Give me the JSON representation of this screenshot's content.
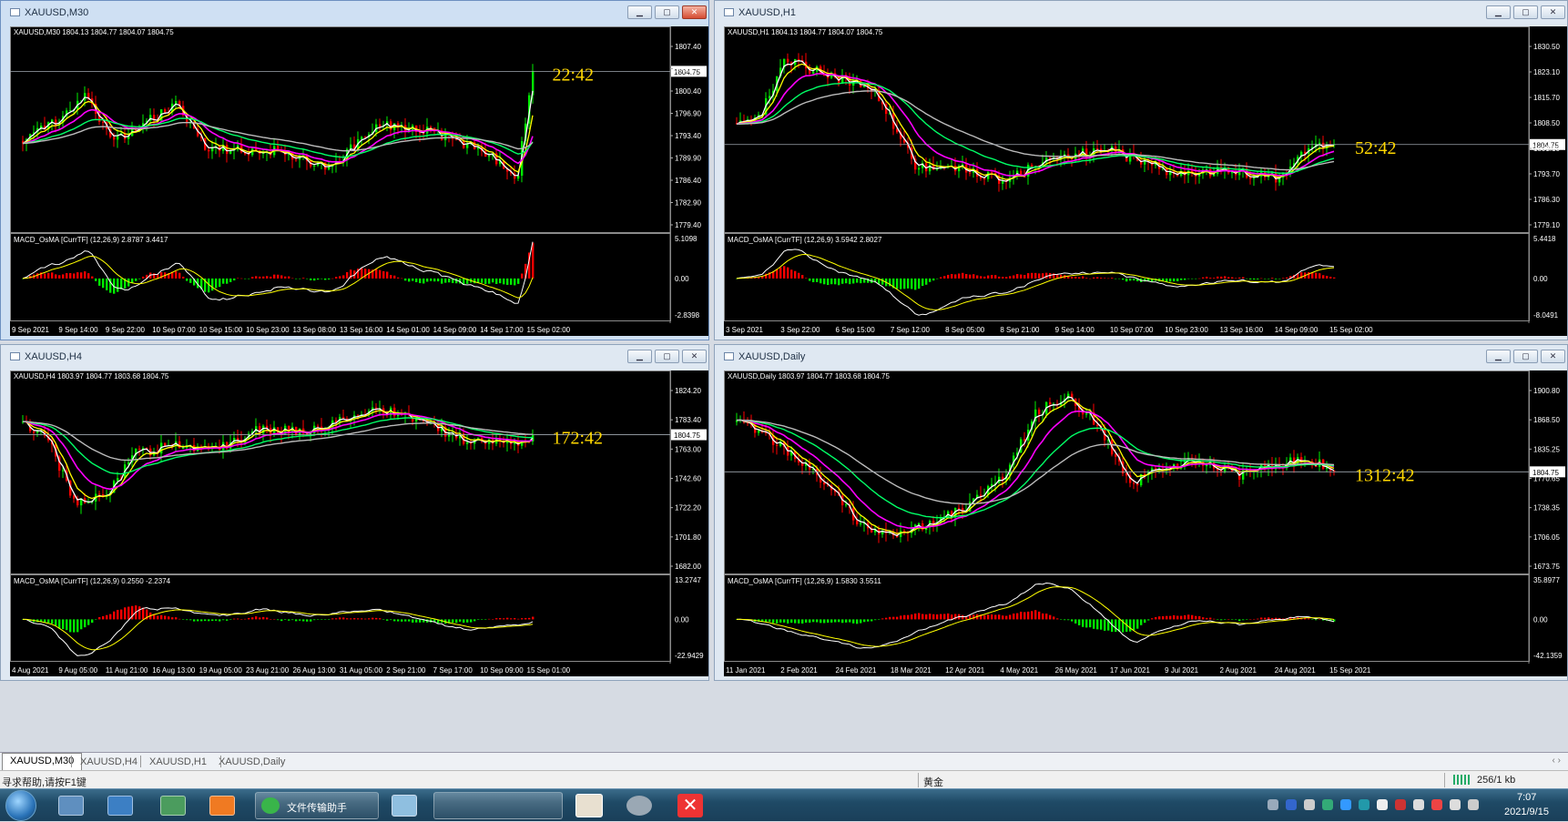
{
  "colors": {
    "bull": "#00ee00",
    "bear": "#ff0000",
    "wma": "#ffffff",
    "ema1": "#ffff00",
    "ema2": "#ff00ff",
    "ema3": "#00ff66",
    "sma": "#bbbbbb",
    "timer": "#ffd700",
    "grid_label": "#ffffff",
    "price_line": "#a0a8b0"
  },
  "windows": [
    {
      "key": "m30",
      "title": "XAUUSD,M30",
      "header": "XAUUSD,M30  1804.13 1804.77 1804.07 1804.75",
      "timer": "22:42",
      "current_price_label": "1804.75",
      "price_ticks": [
        "1807.40",
        "1803.50",
        "1800.40",
        "1796.90",
        "1793.40",
        "1789.90",
        "1786.40",
        "1782.90",
        "1779.40"
      ],
      "macd_title": "MACD_OsMA [CurrTF] (12,26,9) 2.8787 3.4417",
      "macd_ticks": [
        "5.1098",
        "0.00",
        "-2.8398"
      ],
      "time_labels": [
        "9 Sep 2021",
        "9 Sep 14:00",
        "9 Sep 22:00",
        "10 Sep 07:00",
        "10 Sep 15:00",
        "10 Sep 23:00",
        "13 Sep 08:00",
        "13 Sep 16:00",
        "14 Sep 01:00",
        "14 Sep 09:00",
        "14 Sep 17:00",
        "15 Sep 02:00"
      ]
    },
    {
      "key": "h1",
      "title": "XAUUSD,H1",
      "header": "XAUUSD,H1  1804.13 1804.77 1804.07 1804.75",
      "timer": "52:42",
      "current_price_label": "1804.75",
      "price_ticks": [
        "1830.50",
        "1823.10",
        "1815.70",
        "1808.50",
        "1801.10",
        "1793.70",
        "1786.30",
        "1779.10"
      ],
      "macd_title": "MACD_OsMA [CurrTF] (12,26,9) 3.5942 2.8027",
      "macd_ticks": [
        "5.4418",
        "0.00",
        "-8.0491"
      ],
      "time_labels": [
        "3 Sep 2021",
        "3 Sep 22:00",
        "6 Sep 15:00",
        "7 Sep 12:00",
        "8 Sep 05:00",
        "8 Sep 21:00",
        "9 Sep 14:00",
        "10 Sep 07:00",
        "10 Sep 23:00",
        "13 Sep 16:00",
        "14 Sep 09:00",
        "15 Sep 02:00"
      ]
    },
    {
      "key": "h4",
      "title": "XAUUSD,H4",
      "header": "XAUUSD,H4  1803.97 1804.77 1803.68 1804.75",
      "timer": "172:42",
      "current_price_label": "1804.75",
      "price_ticks": [
        "1824.20",
        "1783.40",
        "1763.00",
        "1742.60",
        "1722.20",
        "1701.80",
        "1682.00"
      ],
      "macd_title": "MACD_OsMA [CurrTF] (12,26,9) 0.2550 -2.2374",
      "macd_ticks": [
        "13.2747",
        "0.00",
        "-22.9429"
      ],
      "time_labels": [
        "4 Aug 2021",
        "9 Aug 05:00",
        "11 Aug 21:00",
        "16 Aug 13:00",
        "19 Aug 05:00",
        "23 Aug 21:00",
        "26 Aug 13:00",
        "31 Aug 05:00",
        "2 Sep 21:00",
        "7 Sep 17:00",
        "10 Sep 09:00",
        "15 Sep 01:00"
      ]
    },
    {
      "key": "d1",
      "title": "XAUUSD,Daily",
      "header": "XAUUSD,Daily  1803.97 1804.77 1803.68 1804.75",
      "timer": "1312:42",
      "current_price_label": "1804.75",
      "price_ticks": [
        "1900.80",
        "1868.50",
        "1835.25",
        "1770.65",
        "1738.35",
        "1706.05",
        "1673.75"
      ],
      "macd_title": "MACD_OsMA [CurrTF] (12,26,9) 1.5830 3.5511",
      "macd_ticks": [
        "35.8977",
        "0.00",
        "-42.1359"
      ],
      "time_labels": [
        "11 Jan 2021",
        "2 Feb 2021",
        "24 Feb 2021",
        "18 Mar 2021",
        "12 Apr 2021",
        "4 May 2021",
        "26 May 2021",
        "17 Jun 2021",
        "9 Jul 2021",
        "2 Aug 2021",
        "24 Aug 2021",
        "15 Sep 2021"
      ]
    }
  ],
  "tabs": [
    "XAUUSD,M30",
    "XAUUSD,H4",
    "XAUUSD,H1",
    "XAUUSD,Daily"
  ],
  "tab_nav": "‹ ›",
  "status": {
    "help": "寻求帮助,请按F1键",
    "profile": "黄金",
    "traffic": "256/1 kb"
  },
  "taskbar": {
    "wechat_label": "文件传输助手",
    "time": "7:07",
    "date": "2021/9/15"
  },
  "icons": {
    "start": "windows-orb-icon",
    "explorer": "explorer-icon",
    "desktop": "desktop-icon",
    "network": "network-icon",
    "browser": "browser-icon",
    "wechat": "wechat-icon"
  }
}
